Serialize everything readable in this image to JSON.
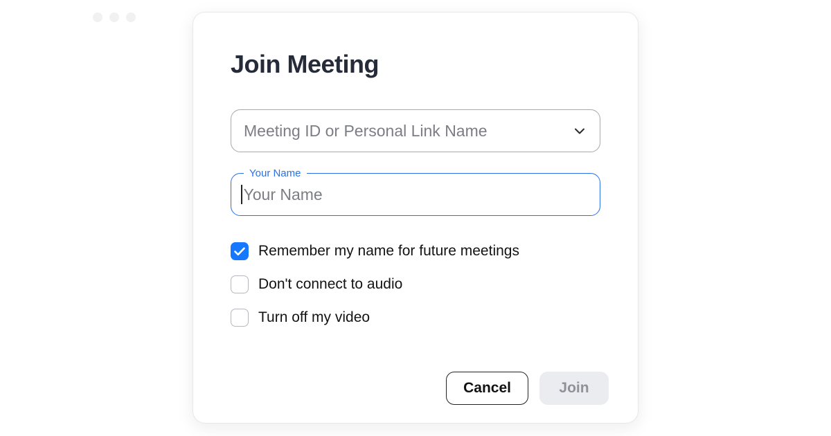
{
  "dialog": {
    "title": "Join Meeting",
    "meeting_id": {
      "placeholder": "Meeting ID or Personal Link Name",
      "value": ""
    },
    "name_field": {
      "label": "Your Name",
      "placeholder": "Your Name",
      "value": ""
    },
    "options": {
      "remember_name": {
        "label": "Remember my name for future meetings",
        "checked": true
      },
      "no_audio": {
        "label": "Don't connect to audio",
        "checked": false
      },
      "no_video": {
        "label": "Turn off my video",
        "checked": false
      }
    },
    "buttons": {
      "cancel": "Cancel",
      "join": "Join"
    }
  },
  "colors": {
    "accent": "#1677ff",
    "focus_border": "#2870ea"
  }
}
